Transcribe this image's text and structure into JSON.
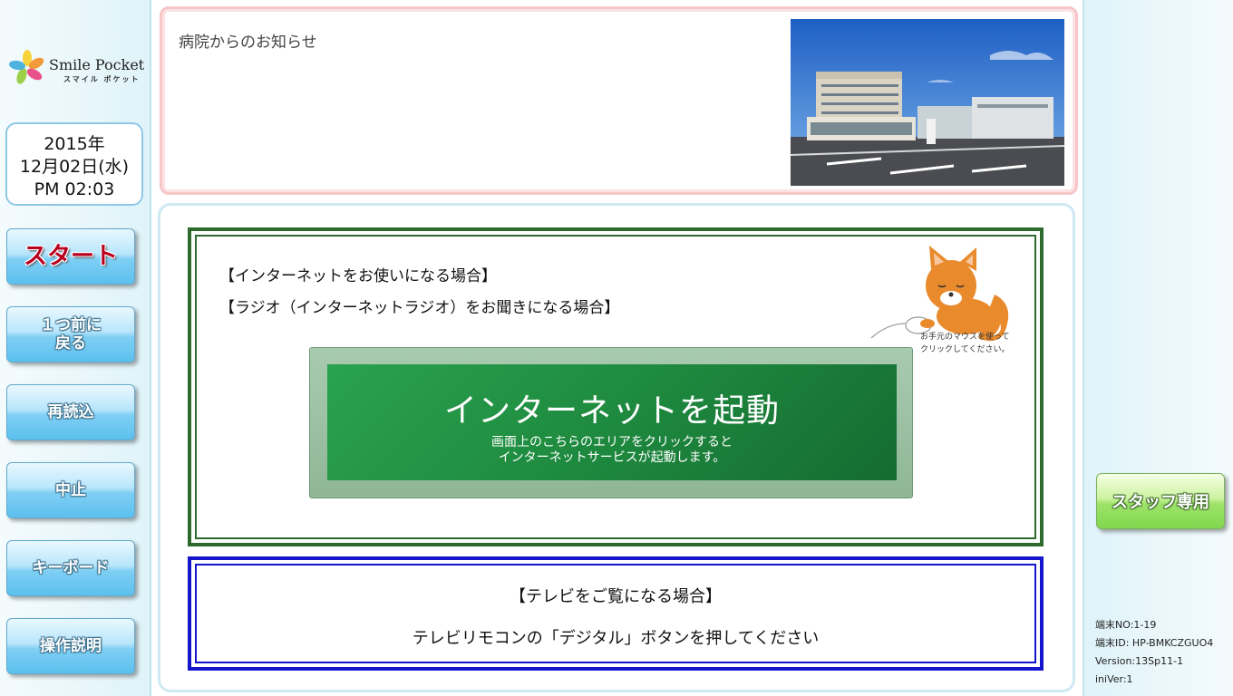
{
  "logo": {
    "name": "Smile Pocket",
    "sub": "スマイル ポケット"
  },
  "clock": {
    "year": "2015年",
    "date": "12月02日(水)",
    "time": "PM 02:03"
  },
  "sidebar": {
    "start_label": "スタート",
    "back_label": "１つ前に\n戻る",
    "reload_label": "再読込",
    "stop_label": "中止",
    "keyboard_label": "キーボード",
    "help_label": "操作説明"
  },
  "notice": {
    "title": "病院からのお知らせ"
  },
  "internet": {
    "line1": "【インターネットをお使いになる場合】",
    "line2": "【ラジオ（インターネットラジオ）をお聞きになる場合】",
    "fox_caption_1": "お手元のマウスを使って",
    "fox_caption_2": "クリックしてください。",
    "launch_title": "インターネットを起動",
    "launch_desc": "画面上のこちらのエリアをクリックすると\nインターネットサービスが起動します。"
  },
  "tv": {
    "title": "【テレビをご覧になる場合】",
    "desc": "テレビリモコンの「デジタル」ボタンを押してください"
  },
  "staff": {
    "label": "スタッフ専用"
  },
  "terminal": {
    "no": "端末NO:1-19",
    "id": "端末ID: HP-BMKCZGUO4",
    "version": "Version:13Sp11-1",
    "iniver": "iniVer:1"
  },
  "colors": {
    "notice_border": "#f7c6c9",
    "main_border": "#cfe9f3",
    "internet_border": "#2e6a2e",
    "tv_border": "#1515cc",
    "launch_green": "#1e8a3f",
    "start_text": "#b8001e"
  }
}
